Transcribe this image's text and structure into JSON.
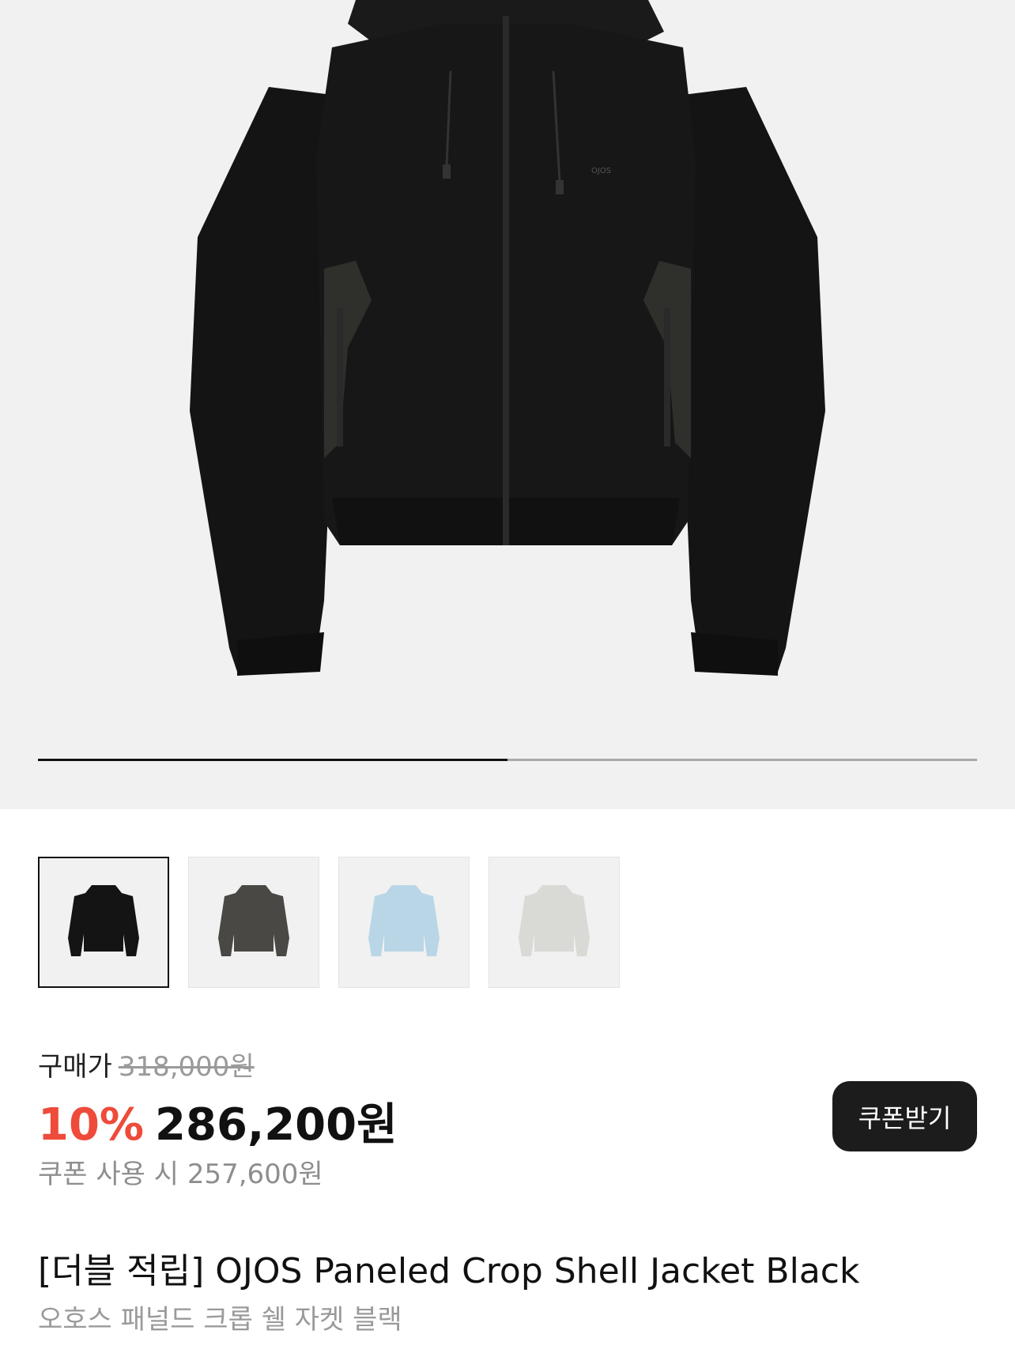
{
  "gallery": {
    "main_image": "black-paneled-crop-shell-jacket-photo",
    "jacket_logo": "OJOS",
    "progress": 0.5,
    "thumbnails": [
      {
        "name": "black",
        "color": "#141414",
        "selected": true
      },
      {
        "name": "charcoal",
        "color": "#4a4845",
        "selected": false
      },
      {
        "name": "sky-blue",
        "color": "#b9d6e6",
        "selected": false
      },
      {
        "name": "light-grey",
        "color": "#d9d9d6",
        "selected": false
      }
    ]
  },
  "price": {
    "label": "구매가",
    "original": "318,000원",
    "discount": "10%",
    "sale": "286,200원",
    "coupon_text": "쿠폰 사용 시 257,600원",
    "coupon_button": "쿠폰받기",
    "discount_color": "#ee4b3b"
  },
  "product": {
    "title": "[더블 적립] OJOS Paneled Crop Shell Jacket Black",
    "subtitle": "오호스 패널드 크롭 쉘 자켓 블랙"
  }
}
